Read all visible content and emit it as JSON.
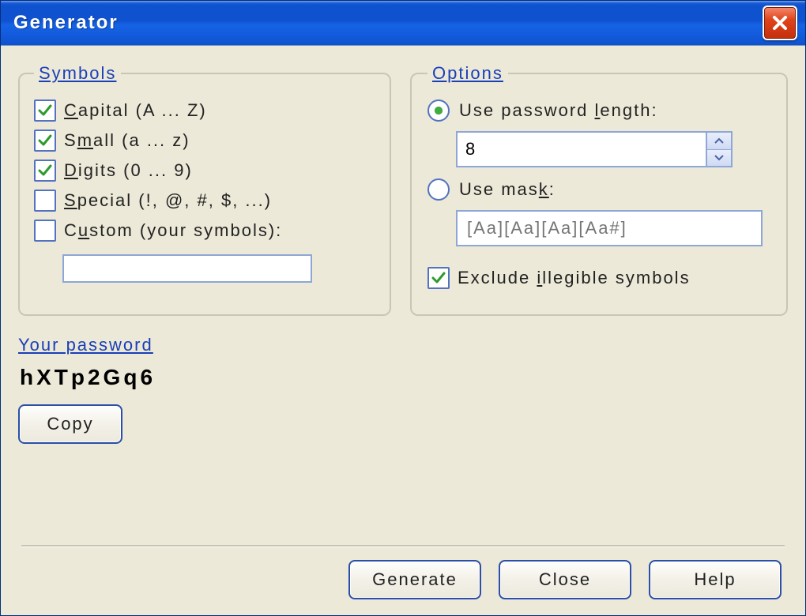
{
  "window": {
    "title": "Generator"
  },
  "symbols": {
    "legend": "Symbols",
    "capital": {
      "checked": true,
      "label_pre": "C",
      "label_rest": "apital (A ... Z)"
    },
    "small": {
      "checked": true,
      "label_pre": "S",
      "label_accel": "m",
      "label_rest": "all (a ... z)"
    },
    "digits": {
      "checked": true,
      "label_pre": "D",
      "label_rest": "igits (0 ... 9)"
    },
    "special": {
      "checked": false,
      "label_pre": "S",
      "label_rest": "pecial (!, @, #, $, ...)"
    },
    "custom": {
      "checked": false,
      "label_pre": "C",
      "label_accel": "u",
      "label_rest": "stom (your symbols):",
      "value": ""
    }
  },
  "options": {
    "legend": "Options",
    "use_length": {
      "selected": true,
      "label_pre": "Use password ",
      "label_accel": "l",
      "label_rest": "ength:",
      "value": "8"
    },
    "use_mask": {
      "selected": false,
      "label_pre": "Use mas",
      "label_accel": "k",
      "label_rest": ":",
      "placeholder": "[Aa][Aa][Aa][Aa#]",
      "value": ""
    },
    "exclude": {
      "checked": true,
      "label_pre": "Exclude ",
      "label_accel": "i",
      "label_rest": "llegible symbols"
    }
  },
  "password": {
    "section_label": "Your password",
    "value": "hXTp2Gq6",
    "copy_label": "Copy"
  },
  "buttons": {
    "generate": "Generate",
    "close": "Close",
    "help": "Help"
  }
}
